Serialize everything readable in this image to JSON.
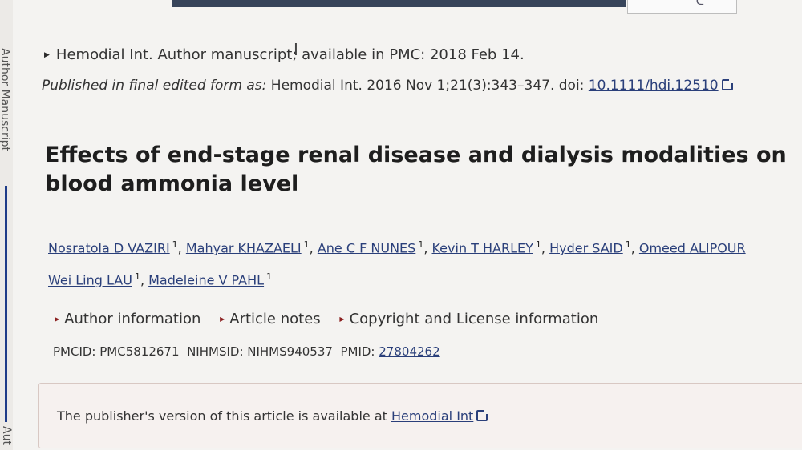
{
  "manuscript_line": "Hemodial Int. Author manuscript; available in PMC: 2018 Feb 14.",
  "published": {
    "prefix": "Published in final edited form as:",
    "citation": " Hemodial Int. 2016 Nov 1;21(3):343–347. doi: ",
    "doi": "10.1111/hdi.12510"
  },
  "title": "Effects of end-stage renal disease and dialysis modalities on blood ammonia level",
  "authors": [
    {
      "name": "Nosratola D VAZIRI",
      "aff": "1"
    },
    {
      "name": "Mahyar KHAZAELI",
      "aff": "1"
    },
    {
      "name": "Ane C F NUNES",
      "aff": "1"
    },
    {
      "name": "Kevin T HARLEY",
      "aff": "1"
    },
    {
      "name": "Hyder SAID",
      "aff": "1"
    },
    {
      "name": "Omeed ALIPOUR",
      "aff": ""
    },
    {
      "name": "Wei Ling LAU",
      "aff": "1"
    },
    {
      "name": "Madeleine V PAHL",
      "aff": "1"
    }
  ],
  "toggles": [
    "Author information",
    "Article notes",
    "Copyright and License information"
  ],
  "ids": {
    "pmcid": "PMCID: PMC5812671",
    "nihmsid": "NIHMSID: NIHMS940537",
    "pmid_label": "PMID:",
    "pmid": "27804262"
  },
  "publisher_box": {
    "text": "The publisher's version of this article is available at ",
    "link": "Hemodial Int"
  },
  "side_text_top": "Author Manuscript",
  "side_text_bottom": "Aut"
}
